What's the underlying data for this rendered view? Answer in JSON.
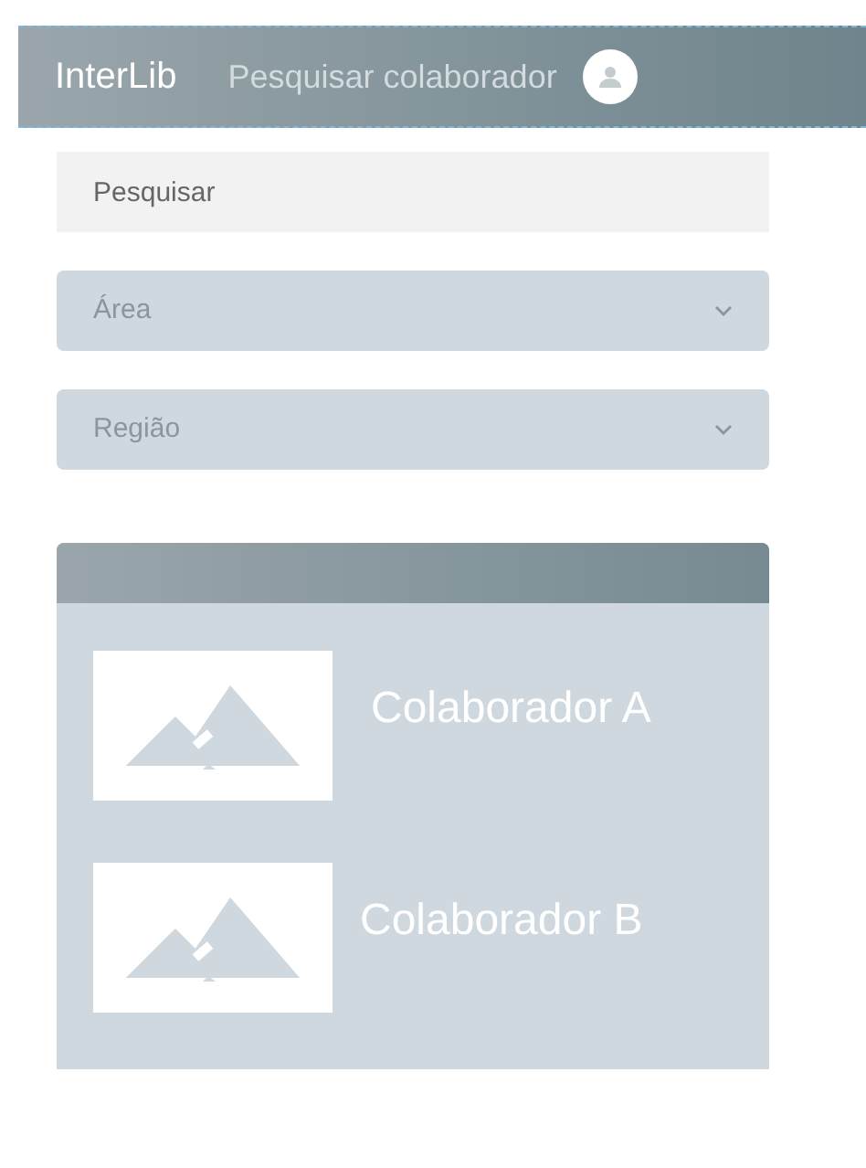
{
  "header": {
    "brand": "InterLib",
    "title": "Pesquisar colaborador"
  },
  "search": {
    "placeholder": "Pesquisar"
  },
  "filters": [
    {
      "label": "Área"
    },
    {
      "label": "Região"
    }
  ],
  "results": [
    {
      "name": "Colaborador A"
    },
    {
      "name": "Colaborador B"
    }
  ]
}
